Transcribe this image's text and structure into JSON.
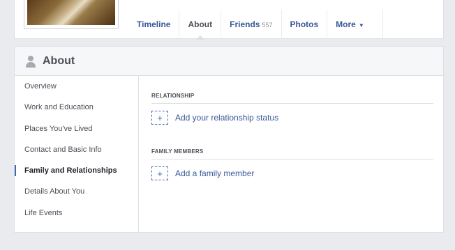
{
  "tabs": [
    {
      "label": "Timeline"
    },
    {
      "label": "About"
    },
    {
      "label": "Friends",
      "count": "557"
    },
    {
      "label": "Photos"
    },
    {
      "label": "More",
      "caret": "▼"
    }
  ],
  "section": {
    "title": "About",
    "icon": "person-icon"
  },
  "sidebar": {
    "items": [
      {
        "label": "Overview"
      },
      {
        "label": "Work and Education"
      },
      {
        "label": "Places You've Lived"
      },
      {
        "label": "Contact and Basic Info"
      },
      {
        "label": "Family and Relationships",
        "active": true
      },
      {
        "label": "Details About You"
      },
      {
        "label": "Life Events"
      }
    ]
  },
  "main": {
    "relationship": {
      "heading": "RELATIONSHIP",
      "add_label": "Add your relationship status",
      "plus": "+"
    },
    "family": {
      "heading": "FAMILY MEMBERS",
      "add_label": "Add a family member",
      "plus": "+"
    }
  },
  "colors": {
    "link": "#385898",
    "accent": "#4267b2",
    "background": "#e9ebee"
  }
}
